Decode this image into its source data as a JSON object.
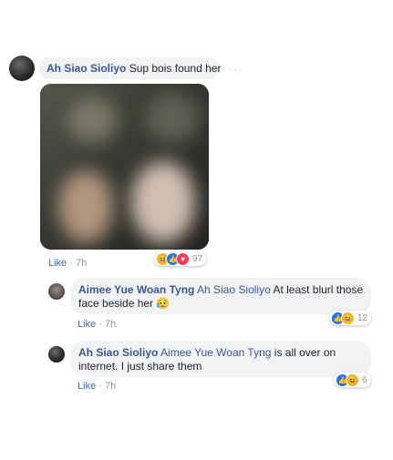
{
  "post": {
    "author": "Ah Siao Sioliyo",
    "text": "Sup bois found her",
    "more_label": "···",
    "actions": {
      "like": "Like",
      "separator": "·",
      "time": "7h"
    },
    "reactions": {
      "icons": [
        "haha-icon",
        "like-icon",
        "love-icon"
      ],
      "count": "97"
    }
  },
  "replies": [
    {
      "author": "Aimee Yue Woan Tyng",
      "mention": "Ah Siao Sioliyo",
      "text": "At least blurl those face beside her",
      "emoji": "😥",
      "actions": {
        "like": "Like",
        "separator": "·",
        "time": "7h"
      },
      "reactions": {
        "icons": [
          "like-icon",
          "haha-icon"
        ],
        "count": "12"
      }
    },
    {
      "author": "Ah Siao Sioliyo",
      "mention": "Aimee Yue Woan Tyng",
      "text": "is all over on internet. I just share them",
      "actions": {
        "like": "Like",
        "separator": "·",
        "time": "7h"
      },
      "reactions": {
        "icons": [
          "like-icon",
          "haha-icon"
        ],
        "count": "6"
      }
    }
  ],
  "colors": {
    "link": "#385898",
    "like": "#4267b2",
    "bubble": "#f2f3f5",
    "meta": "#90949c"
  }
}
